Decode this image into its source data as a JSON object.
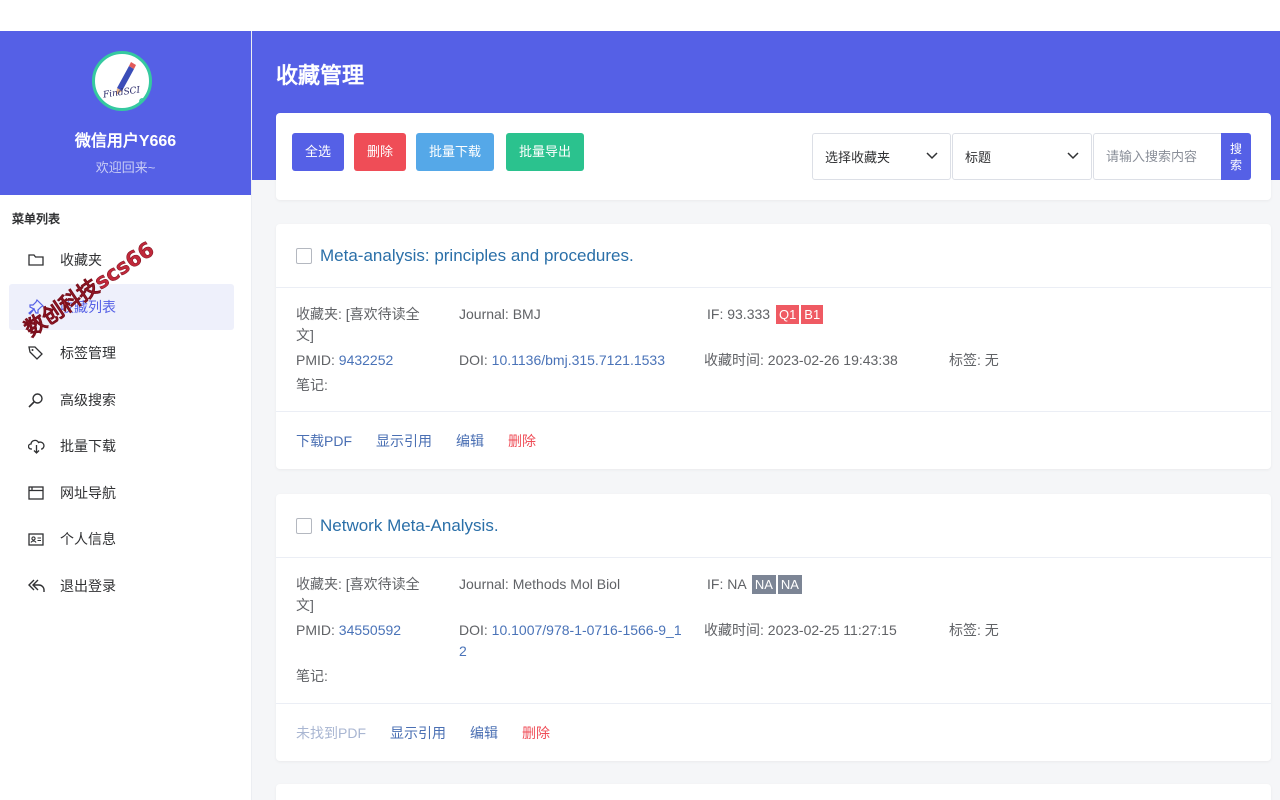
{
  "user": {
    "name": "微信用户Y666",
    "welcome": "欢迎回来~",
    "logo_text": "FindSCI"
  },
  "menu": {
    "title": "菜单列表",
    "items": [
      {
        "label": "收藏夹",
        "icon": "folder-icon"
      },
      {
        "label": "收藏列表",
        "icon": "pin-icon",
        "active": true
      },
      {
        "label": "标签管理",
        "icon": "tag-icon"
      },
      {
        "label": "高级搜索",
        "icon": "search-icon"
      },
      {
        "label": "批量下载",
        "icon": "cloud-download-icon"
      },
      {
        "label": "网址导航",
        "icon": "browser-icon"
      },
      {
        "label": "个人信息",
        "icon": "id-card-icon"
      },
      {
        "label": "退出登录",
        "icon": "logout-icon"
      }
    ]
  },
  "watermark": "数创科技scs66",
  "page_title": "收藏管理",
  "toolbar": {
    "select_all": "全选",
    "delete": "删除",
    "bulk_download": "批量下载",
    "bulk_export": "批量导出",
    "folder_select": "选择收藏夹",
    "field_select": "标题",
    "search_placeholder": "请输入搜索内容",
    "search_button": "搜索"
  },
  "labels": {
    "folder": "收藏夹: ",
    "journal": "Journal: ",
    "if": "IF: ",
    "pmid": "PMID: ",
    "doi": "DOI: ",
    "time": "收藏时间: ",
    "tags": "标签: ",
    "notes": "笔记:"
  },
  "articles": [
    {
      "title": "Meta-analysis: principles and procedures.",
      "folder": "[喜欢待读全文]",
      "journal": "BMJ",
      "if": "93.333",
      "quartile": "Q1",
      "category": "B1",
      "badge_color": "red",
      "pmid": "9432252",
      "doi": "10.1136/bmj.315.7121.1533",
      "saved_time": "2023-02-26 19:43:38",
      "tags": "无",
      "notes": "",
      "actions": {
        "pdf": "下载PDF",
        "pdf_available": true,
        "cite": "显示引用",
        "edit": "编辑",
        "delete": "删除"
      }
    },
    {
      "title": "Network Meta-Analysis.",
      "folder": "[喜欢待读全文]",
      "journal": "Methods Mol Biol",
      "if": "NA",
      "quartile": "NA",
      "category": "NA",
      "badge_color": "gray",
      "pmid": "34550592",
      "doi": "10.1007/978-1-0716-1566-9_12",
      "saved_time": "2023-02-25 11:27:15",
      "tags": "无",
      "notes": "",
      "actions": {
        "pdf": "未找到PDF",
        "pdf_available": false,
        "cite": "显示引用",
        "edit": "编辑",
        "delete": "删除"
      }
    }
  ]
}
